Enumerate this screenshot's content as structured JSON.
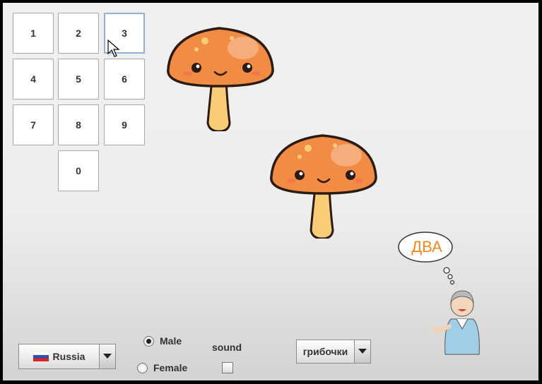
{
  "numpad": {
    "keys": [
      "1",
      "2",
      "3",
      "4",
      "5",
      "6",
      "7",
      "8",
      "9",
      "0"
    ],
    "focused_key": "3"
  },
  "speech_bubble": {
    "text": "ДВА"
  },
  "language_combo": {
    "value": "Russia",
    "flag": "russia-flag-icon"
  },
  "voice": {
    "male_label": "Male",
    "female_label": "Female",
    "selected": "Male"
  },
  "sound": {
    "label": "sound",
    "checked": false
  },
  "theme_combo": {
    "value": "грибочки"
  },
  "colors": {
    "mushroom_cap": "#f28b44",
    "mushroom_stem": "#f9cd77",
    "outline": "#2b1b12",
    "bubble_text": "#f08a1c"
  }
}
